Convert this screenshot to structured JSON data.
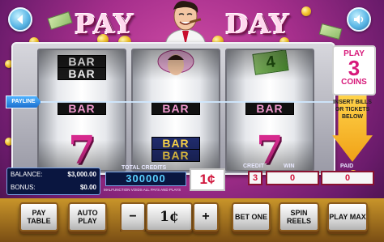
{
  "game": {
    "title_left": "PAY",
    "title_right": "DAY"
  },
  "reels": {
    "payline_label": "PAYLINE",
    "reel1": {
      "top": "BAR",
      "top2": "BAR",
      "middle": "BAR",
      "bottom": "7"
    },
    "reel2": {
      "middle": "BAR",
      "bottom_top": "BAR",
      "bottom_low": "BAR"
    },
    "reel3": {
      "top": "4",
      "middle": "BAR",
      "bottom": "7"
    }
  },
  "play_box": {
    "line1": "PLAY",
    "count": "3",
    "line3": "COINS"
  },
  "insert": {
    "text": "INSERT BILLS OR TICKETS BELOW"
  },
  "balance": {
    "balance_label": "BALANCE:",
    "balance_value": "$3,000.00",
    "bonus_label": "BONUS:",
    "bonus_value": "$0.00"
  },
  "credits": {
    "total_label": "TOTAL CREDITS",
    "total_value": "300000",
    "malfunction": "MALFUNCTION VOIDS ALL PAYS AND PLAYS"
  },
  "denomination": "1¢",
  "meters": {
    "credit_label": "CREDIT",
    "credit_value": "3",
    "win_label": "WIN",
    "win_value": "0",
    "paid_label": "PAID",
    "paid_value": "0"
  },
  "buttons": {
    "pay_table": "PAY TABLE",
    "auto_play": "AUTO PLAY",
    "denom_minus": "−",
    "denom_value": "1¢",
    "denom_plus": "+",
    "bet_one": "BET ONE",
    "spin_reels": "SPIN REELS",
    "play_max": "PLAY MAX"
  },
  "colors": {
    "accent_pink": "#d7197a",
    "panel_blue": "#0a1640",
    "button_gold": "#c9952a"
  },
  "icons": {
    "left_round_button": "back-icon",
    "right_round_button": "sound-icon"
  }
}
